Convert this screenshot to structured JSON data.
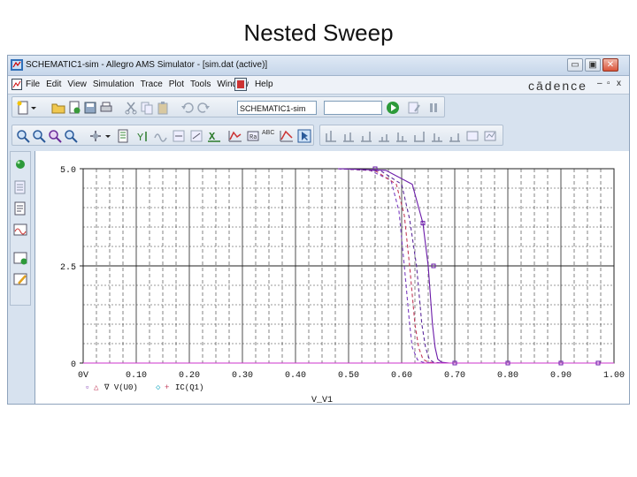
{
  "slide": {
    "title": "Nested Sweep"
  },
  "window": {
    "title": "SCHEMATIC1-sim - Allegro AMS Simulator - [sim.dat (active)]",
    "buttons": {
      "minimize": "▭",
      "maximize": "▣",
      "close": "✕"
    }
  },
  "menubar": {
    "items": [
      "File",
      "Edit",
      "View",
      "Simulation",
      "Trace",
      "Plot",
      "Tools",
      "Window",
      "Help"
    ],
    "brand": "cādence",
    "mdi_controls": {
      "minimize": "–",
      "restore": "▫",
      "close": "x"
    }
  },
  "toolbar": {
    "simulation_profile": "SCHEMATIC1-sim",
    "text_tool_label": "ABC"
  },
  "plot": {
    "x_title": "V_V1",
    "legend": [
      {
        "marker": "▫",
        "symbol": "△",
        "text": "∇ V(U0)"
      },
      {
        "marker": "◇",
        "symbol": "+",
        "text": "IC(Q1)"
      }
    ]
  },
  "chart_data": {
    "type": "line",
    "xlabel": "V_V1",
    "xlim": [
      0,
      1.0
    ],
    "ylim": [
      0,
      5.0
    ],
    "x_tick_labels": [
      "0V",
      "0.10",
      "0.20",
      "0.30",
      "0.40",
      "0.50",
      "0.60",
      "0.70",
      "0.80",
      "0.90",
      "1.00"
    ],
    "y_tick_labels": [
      {
        "value": 5.0,
        "label": "5.0"
      },
      {
        "value": 2.5,
        "label": "2.5"
      },
      {
        "value": 0,
        "label": "0"
      }
    ],
    "grid": true,
    "series": [
      {
        "color": "#7a3dbf",
        "dash": "4,3",
        "x": [
          0.48,
          0.54,
          0.58,
          0.595,
          0.605,
          0.615,
          0.62,
          0.63,
          0.64,
          0.66
        ],
        "y": [
          5.0,
          4.96,
          4.7,
          3.9,
          2.5,
          1.0,
          0.4,
          0.08,
          0.02,
          0
        ]
      },
      {
        "color": "#c23a5a",
        "dash": "4,3",
        "x": [
          0.48,
          0.55,
          0.59,
          0.605,
          0.615,
          0.625,
          0.632,
          0.64,
          0.65,
          0.67
        ],
        "y": [
          5.0,
          4.95,
          4.6,
          3.8,
          2.5,
          1.0,
          0.4,
          0.1,
          0.02,
          0
        ]
      },
      {
        "color": "#5c2a9c",
        "dash": "4,3",
        "x": [
          0.48,
          0.56,
          0.6,
          0.615,
          0.628,
          0.638,
          0.645,
          0.652,
          0.66,
          0.68
        ],
        "y": [
          5.0,
          4.95,
          4.6,
          3.7,
          2.5,
          1.0,
          0.4,
          0.1,
          0.02,
          0
        ]
      },
      {
        "color": "#6a1aa8",
        "dash": "",
        "x": [
          0.48,
          0.57,
          0.62,
          0.64,
          0.65,
          0.658,
          0.663,
          0.668,
          0.675,
          0.69
        ],
        "y": [
          5.0,
          4.96,
          4.6,
          3.6,
          2.5,
          1.0,
          0.4,
          0.1,
          0.02,
          0
        ]
      },
      {
        "color": "#cc33cc",
        "dash": "",
        "x": [
          0,
          1.0
        ],
        "y": [
          0,
          0
        ]
      }
    ],
    "markers": [
      {
        "color": "#6a1aa8",
        "x": [
          0.55,
          0.64,
          0.66,
          0.7,
          0.8,
          0.9,
          0.97
        ],
        "y": [
          5.0,
          3.6,
          2.5,
          0,
          0,
          0,
          0
        ]
      }
    ]
  }
}
